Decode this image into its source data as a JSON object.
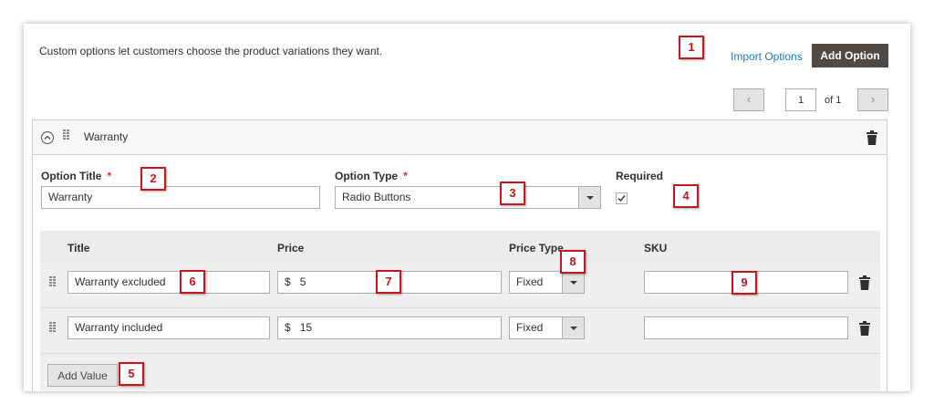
{
  "intro_text": "Custom options let customers choose the product variations they want.",
  "header_actions": {
    "import_label": "Import Options",
    "add_option_label": "Add Option"
  },
  "pager": {
    "prev_icon": "‹",
    "next_icon": "›",
    "current_page": "1",
    "of_label": "of 1"
  },
  "option": {
    "name": "Warranty",
    "title_label": "Option Title",
    "title_value": "Warranty",
    "type_label": "Option Type",
    "type_value": "Radio Buttons",
    "required_label": "Required",
    "required_checked": true,
    "required_star": "*"
  },
  "values_grid": {
    "columns": [
      "Title",
      "Price",
      "Price Type",
      "SKU"
    ],
    "rows": [
      {
        "title": "Warranty excluded",
        "price_prefix": "$",
        "price": "5",
        "price_type": "Fixed",
        "sku": ""
      },
      {
        "title": "Warranty included",
        "price_prefix": "$",
        "price": "15",
        "price_type": "Fixed",
        "sku": ""
      }
    ],
    "add_value_label": "Add Value"
  },
  "callouts": [
    "1",
    "2",
    "3",
    "4",
    "5",
    "6",
    "7",
    "8",
    "9"
  ],
  "icons": {
    "collapse": "collapse-circle-icon",
    "drag": "drag-handle-icon",
    "delete": "trash-icon",
    "dropdown": "chevron-down-icon"
  },
  "colors": {
    "primary_button": "#514943",
    "link": "#1979c3",
    "required": "#e22626",
    "callout": "#c4161c"
  }
}
